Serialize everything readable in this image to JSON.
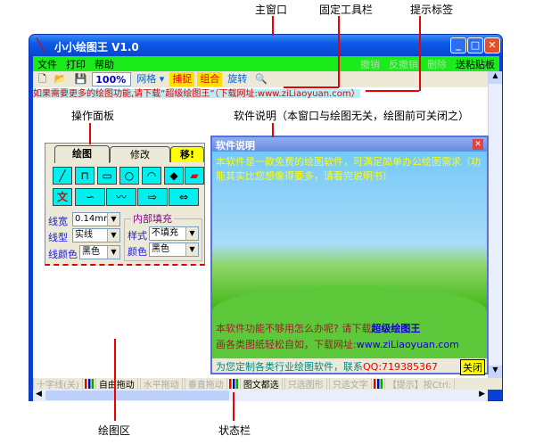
{
  "annotations": {
    "main_window": "主窗口",
    "fixed_toolbar": "固定工具栏",
    "hint_label": "提示标签",
    "panel": "操作面板",
    "software_note": "软件说明（本窗口与绘图无关，绘图前可关闭之）",
    "draw_area": "绘图区",
    "status_bar": "状态栏"
  },
  "window": {
    "title": "小小绘图王 V1.0"
  },
  "menu": {
    "left": [
      "文件",
      "打印",
      "帮助"
    ],
    "right": [
      "撤销",
      "反撤销",
      "删除",
      "送粘贴板"
    ]
  },
  "toolbar": {
    "zoom": "100%",
    "grid": "网格",
    "snap": "捕捉",
    "group": "组合",
    "rotate": "旋转"
  },
  "hint": "如果需要更多的绘图功能,请下载“超级绘图王”（下载网址:www.ziLiaoyuan.com）",
  "panel": {
    "tabs": [
      "绘图",
      "修改",
      "移!"
    ],
    "text_tool": "文",
    "line_width_label": "线宽",
    "line_width": "0.14mm",
    "line_type_label": "线型",
    "line_type": "实线",
    "line_color_label": "线颜色",
    "line_color": "黑色",
    "fill_group": "内部填充",
    "fill_style_label": "样式",
    "fill_style": "不填充",
    "fill_color_label": "颜色",
    "fill_color": "黑色"
  },
  "note": {
    "title": "软件说明",
    "line1": "本软件是一款免费的绘图软件，可满足简单办公绘图需求（功能其实比您想像得要多，请看完说明书）",
    "bottom1a": "本软件功能不够用怎么办呢? 请下载",
    "bottom1b": "超级绘图王",
    "bottom2a": "画各类图纸轻松自如，下载网址:",
    "bottom2b": "www.ziLiaoyuan.com",
    "footer": "为您定制各类行业绘图软件，联系",
    "qq": "QQ:719385367",
    "close": "关闭"
  },
  "status": [
    "十字线(关)",
    "自由拖动",
    "水平拖动",
    "垂直拖动",
    "图文都选",
    "只选图形",
    "只选文字",
    "【提示】按Ctrl:"
  ]
}
